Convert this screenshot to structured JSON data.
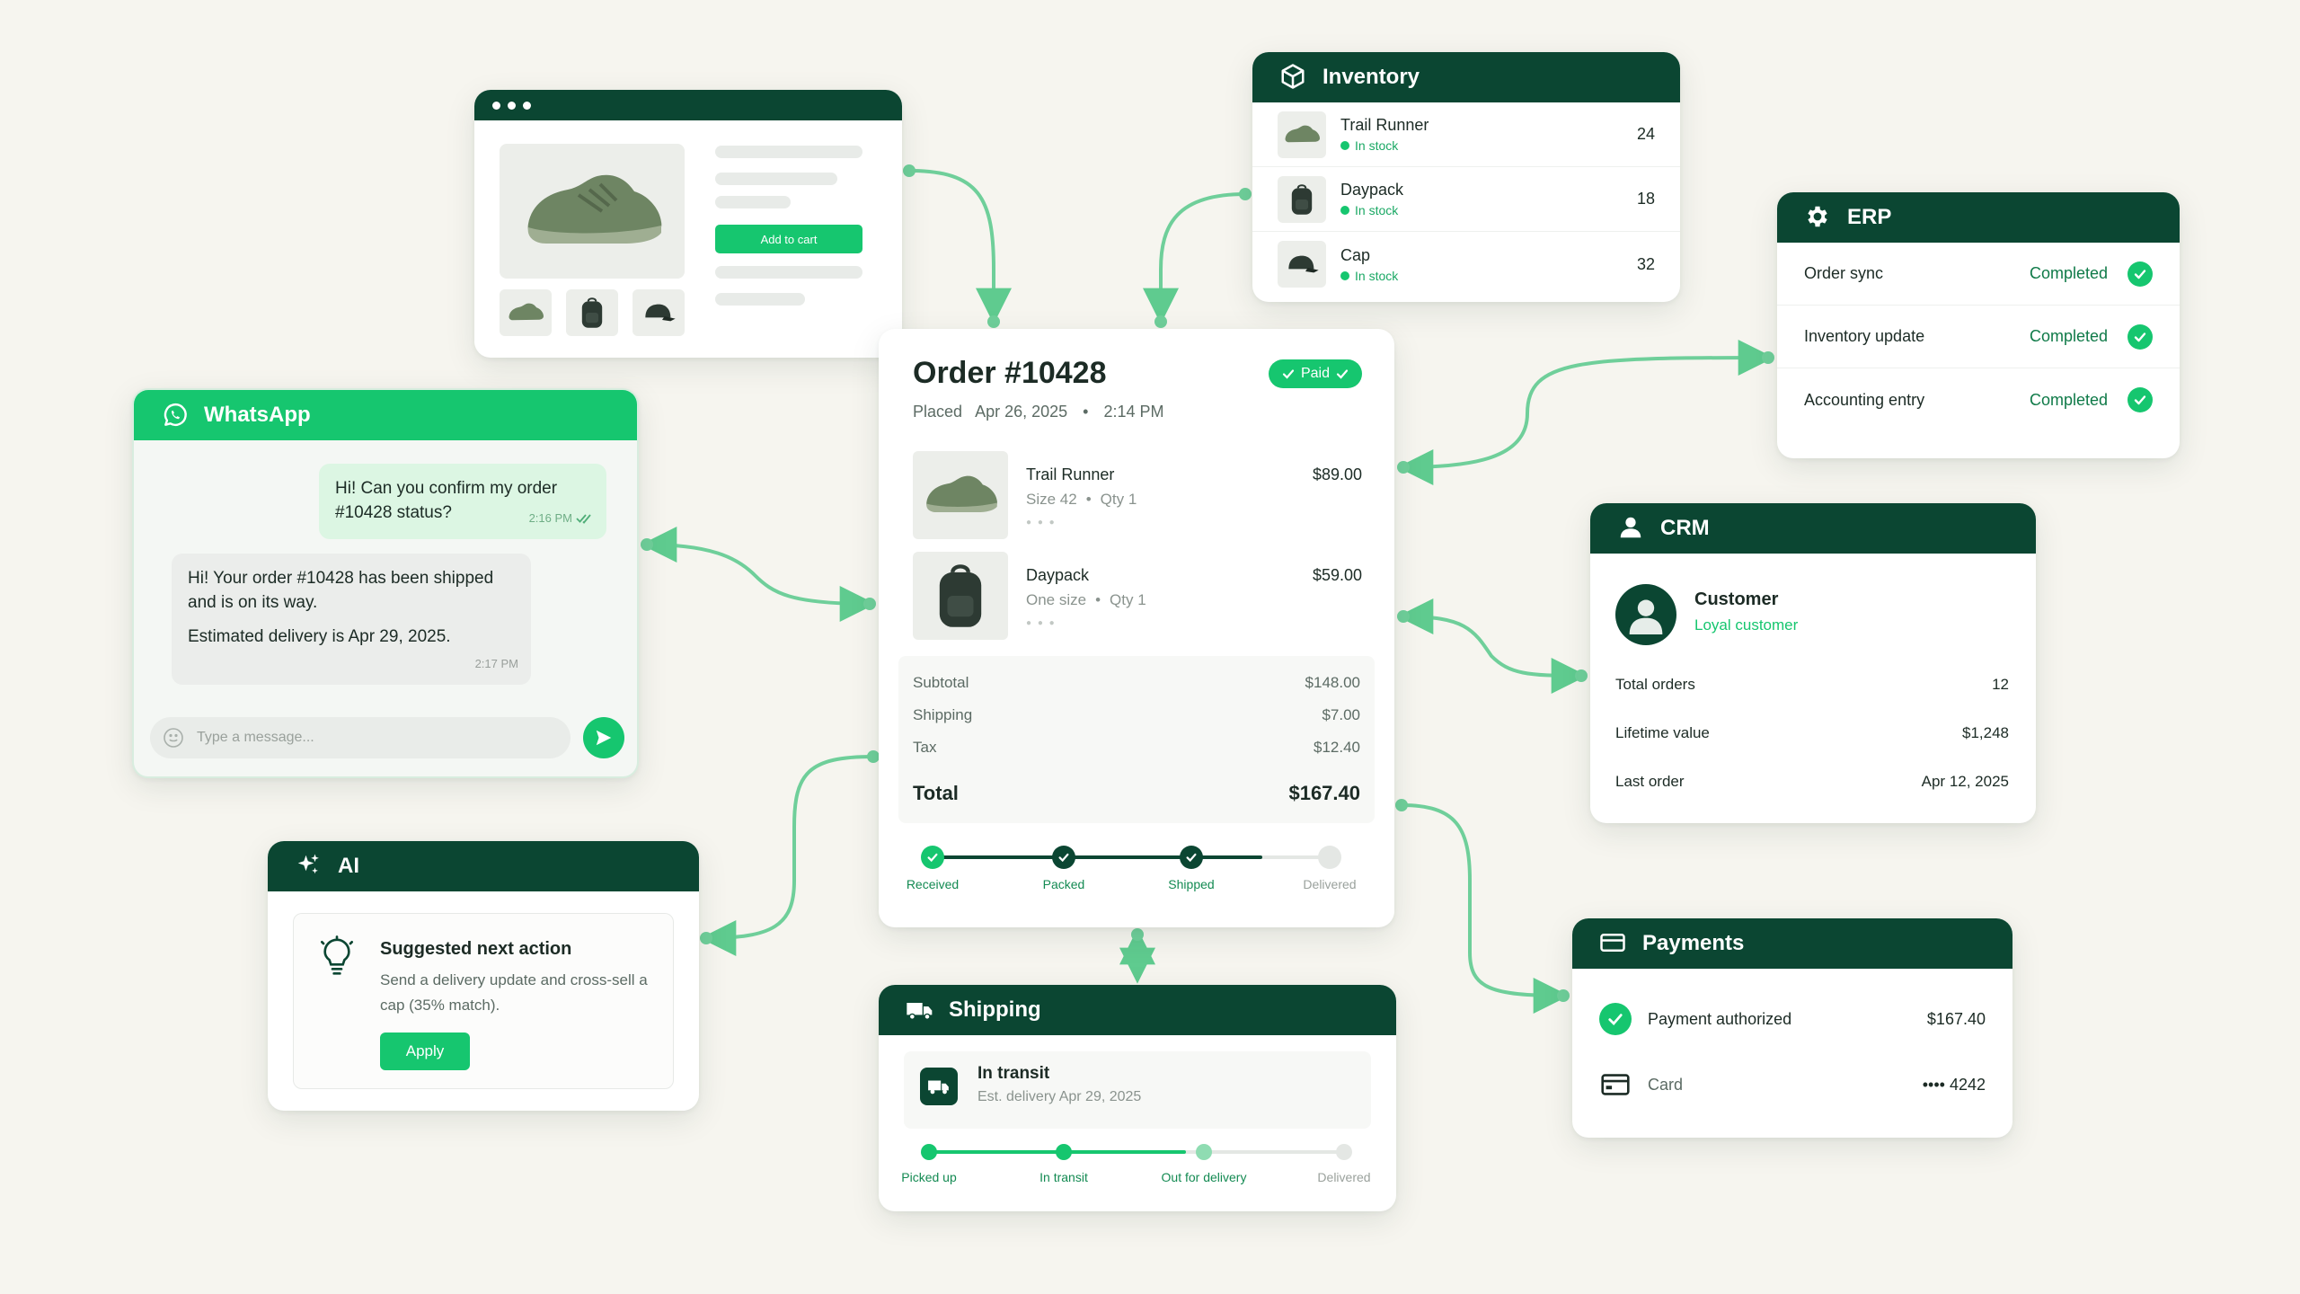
{
  "product": {
    "add_to_cart": "Add to cart"
  },
  "inventory": {
    "title": "Inventory",
    "items": [
      {
        "name": "Trail Runner",
        "status": "In stock",
        "qty": "24"
      },
      {
        "name": "Daypack",
        "status": "In stock",
        "qty": "18"
      },
      {
        "name": "Cap",
        "status": "In stock",
        "qty": "32"
      }
    ]
  },
  "erp": {
    "title": "ERP",
    "rows": [
      {
        "label": "Order sync",
        "status": "Completed"
      },
      {
        "label": "Inventory update",
        "status": "Completed"
      },
      {
        "label": "Accounting entry",
        "status": "Completed"
      }
    ]
  },
  "whatsapp": {
    "title": "WhatsApp",
    "outgoing": {
      "text": "Hi! Can you confirm my order #10428 status?",
      "time": "2:16 PM"
    },
    "incoming": {
      "text1": "Hi! Your order #10428 has been shipped and is on its way.",
      "text2": "Estimated delivery is Apr 29, 2025.",
      "time": "2:17 PM"
    },
    "placeholder": "Type a message..."
  },
  "ai": {
    "title": "AI",
    "heading": "Suggested next action",
    "description": "Send a delivery update and cross-sell a cap (35% match).",
    "apply": "Apply"
  },
  "order": {
    "title": "Order #10428",
    "badge": "Paid",
    "placed_label": "Placed",
    "placed_date": "Apr 26, 2025",
    "placed_time": "2:14 PM",
    "items": [
      {
        "name": "Trail Runner",
        "variant": "Size 42",
        "qty": "Qty 1",
        "price": "$89.00"
      },
      {
        "name": "Daypack",
        "variant": "One size",
        "qty": "Qty 1",
        "price": "$59.00"
      }
    ],
    "subtotal_label": "Subtotal",
    "subtotal": "$148.00",
    "shipping_label": "Shipping",
    "shipping": "$7.00",
    "tax_label": "Tax",
    "tax": "$12.40",
    "total_label": "Total",
    "total": "$167.40",
    "progress": 0.83,
    "steps": [
      {
        "label": "Received",
        "done": true
      },
      {
        "label": "Packed",
        "done": true
      },
      {
        "label": "Shipped",
        "done": true
      },
      {
        "label": "Delivered",
        "done": false
      }
    ]
  },
  "shipping": {
    "title": "Shipping",
    "status": "In transit",
    "eta": "Est. delivery Apr 29, 2025",
    "progress": 0.62,
    "steps": [
      {
        "label": "Picked up",
        "state": "done"
      },
      {
        "label": "In transit",
        "state": "done"
      },
      {
        "label": "Out for delivery",
        "state": "current"
      },
      {
        "label": "Delivered",
        "state": "pending"
      }
    ]
  },
  "crm": {
    "title": "CRM",
    "name": "Customer",
    "tag": "Loyal customer",
    "rows": [
      {
        "label": "Total orders",
        "value": "12"
      },
      {
        "label": "Lifetime value",
        "value": "$1,248"
      },
      {
        "label": "Last order",
        "value": "Apr 12, 2025"
      }
    ]
  },
  "payments": {
    "title": "Payments",
    "authorized_label": "Payment authorized",
    "amount": "$167.40",
    "card_label": "Card",
    "card_number": "•••• 4242"
  },
  "colors": {
    "dark_green": "#0b4632",
    "accent_green": "#16c66f",
    "connector": "#6fcf9a",
    "background": "#f6f5ef"
  }
}
